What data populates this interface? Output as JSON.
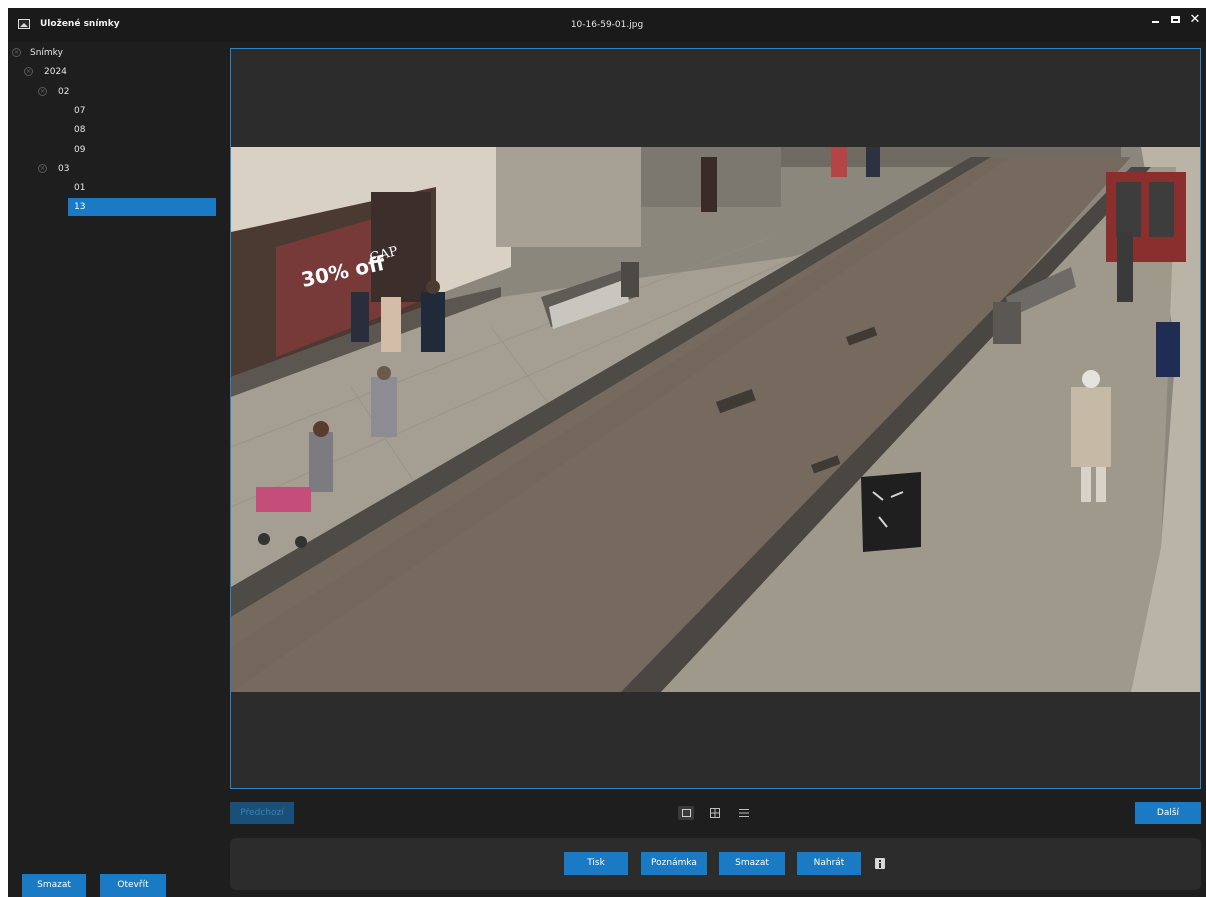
{
  "window": {
    "app_title": "Uložené snímky",
    "file_title": "10-16-59-01.jpg",
    "controls": [
      "minimize-icon",
      "maximize-icon",
      "close-icon"
    ],
    "close_glyph": "✕"
  },
  "sidebar": {
    "tree": [
      {
        "label": "Snímky",
        "level": 0,
        "expanded": true
      },
      {
        "label": "2024",
        "level": 1,
        "expanded": true
      },
      {
        "label": "02",
        "level": 2,
        "expanded": true
      },
      {
        "label": "07",
        "level": 3
      },
      {
        "label": "08",
        "level": 3
      },
      {
        "label": "09",
        "level": 3
      },
      {
        "label": "03",
        "level": 2,
        "expanded": true
      },
      {
        "label": "01",
        "level": 3
      },
      {
        "label": "13",
        "level": 3,
        "selected": true
      }
    ],
    "delete_label": "Smazat",
    "open_label": "Otevřít"
  },
  "viewer": {
    "prev_label": "Předchozí",
    "next_label": "Další",
    "view_modes": [
      "single-view-icon",
      "grid-view-icon",
      "list-view-icon"
    ],
    "active_view_mode": "single-view-icon"
  },
  "actions": {
    "print_label": "Tisk",
    "note_label": "Poznámka",
    "delete_label": "Smazat",
    "upload_label": "Nahrát",
    "info_icon": "info-icon"
  },
  "photo": {
    "storefront_sign": "30% off",
    "shop_letters": "GAP"
  },
  "colors": {
    "accent": "#1a7bc4",
    "background": "#1e1e1e",
    "panel": "#2c2c2c",
    "viewer_border": "#2b84c8"
  }
}
